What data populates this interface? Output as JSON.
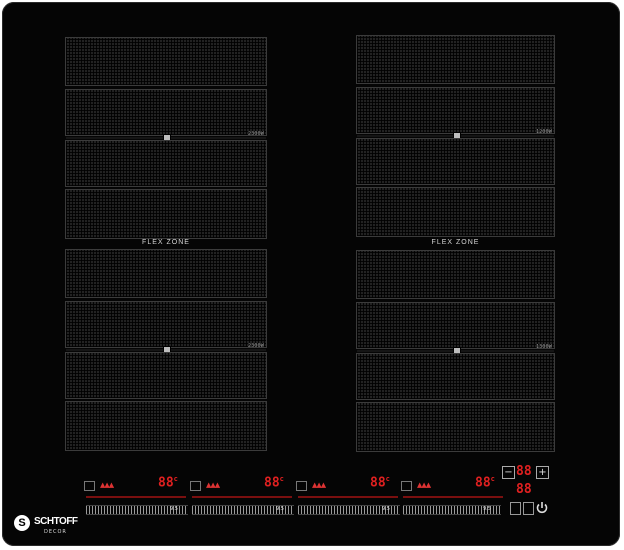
{
  "zones": {
    "left_power_top": "2300W",
    "left_power_bottom": "2300W",
    "right_power_top": "1200W",
    "right_power_bottom": "1300W",
    "flex_label_left": "FLEX ZONE",
    "flex_label_right": "FLEX ZONE"
  },
  "controls": {
    "display_value": "88",
    "display_unit": "c",
    "heat_glyphs": "▲▲▲",
    "slider_label": "9.5",
    "timer_minus": "−",
    "timer_plus": "+",
    "timer_value": "88",
    "timer_value_2": "88"
  },
  "brand": {
    "mark": "S",
    "name": "SCHTOFF",
    "sub": "DECOR"
  },
  "colors": {
    "display_red": "#e02020",
    "glass": "#050505"
  },
  "icons": [
    "lock-icon",
    "power-icon",
    "zone-bridge-icon",
    "heat-indicator-icon"
  ]
}
